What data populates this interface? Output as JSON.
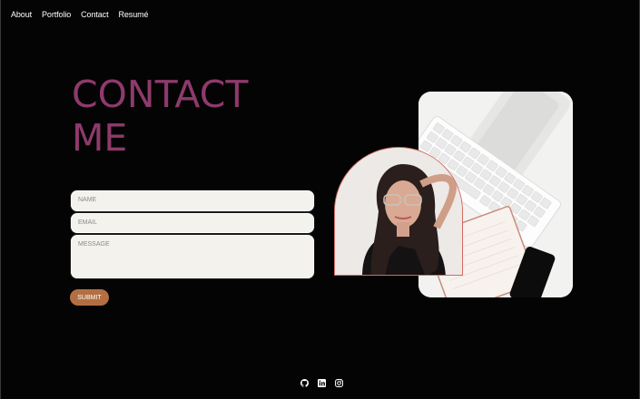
{
  "nav": {
    "items": [
      "About",
      "Portfolio",
      "Contact",
      "Resumé"
    ]
  },
  "contact": {
    "title_line1": "CONTACT",
    "title_line2": "ME",
    "name_placeholder": "NAME",
    "email_placeholder": "EMAIL",
    "message_placeholder": "MESSAGE",
    "submit_label": "SUBMIT"
  },
  "social": {
    "icons": [
      "github-icon",
      "linkedin-icon",
      "instagram-icon"
    ]
  },
  "colors": {
    "background": "#050404",
    "accent": "#8e3a6c",
    "button": "#b36f42",
    "field": "#f3f2ed"
  }
}
